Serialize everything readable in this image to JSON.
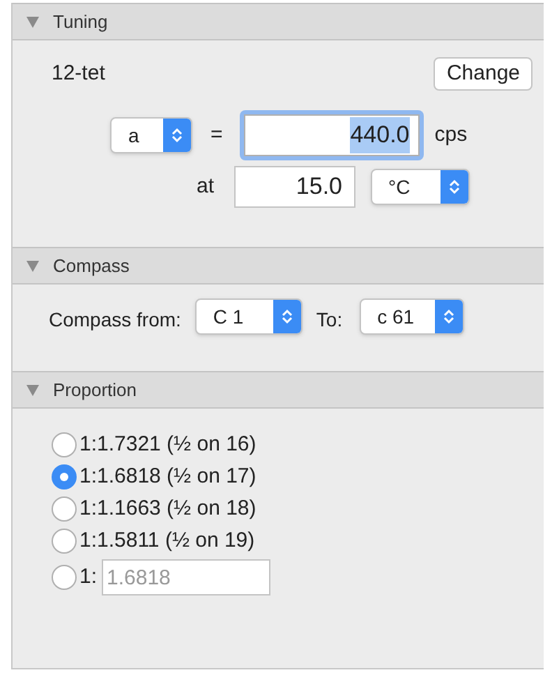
{
  "sections": [
    {
      "title": "Tuning",
      "expanded": true
    },
    {
      "title": "Compass",
      "expanded": true
    },
    {
      "title": "Proportion",
      "expanded": true
    }
  ],
  "tuning": {
    "name": "12-tet",
    "change_button": "Change",
    "note_select": "a",
    "equals": "=",
    "frequency": {
      "value": "440.0",
      "focused": true,
      "text_selected": true
    },
    "unit": "cps",
    "at_label": "at",
    "temperature": {
      "value": "15.0"
    },
    "temp_unit_select": "°C"
  },
  "compass": {
    "from_label": "Compass from:",
    "from_select": "C 1",
    "to_label": "To:",
    "to_select": "c 61"
  },
  "proportion": {
    "options": [
      {
        "kind": "label",
        "label": "1:1.7321 (½ on 16)",
        "selected": false
      },
      {
        "kind": "label",
        "label": "1:1.6818 (½ on 17)",
        "selected": true
      },
      {
        "kind": "label",
        "label": "1:1.1663 (½ on 18)",
        "selected": false
      },
      {
        "kind": "label",
        "label": "1:1.5811 (½ on 19)",
        "selected": false
      },
      {
        "kind": "custom",
        "label": "1:",
        "placeholder": "1.6818",
        "selected": false
      }
    ]
  }
}
